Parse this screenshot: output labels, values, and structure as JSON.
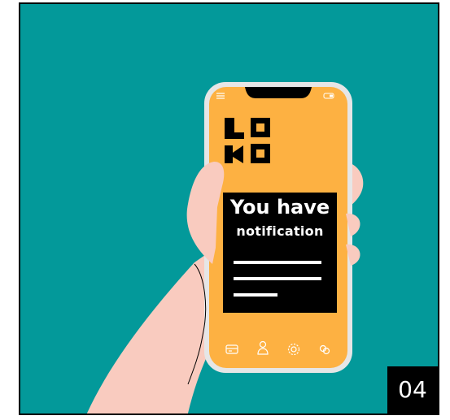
{
  "notification": {
    "title": "You have",
    "subtitle": "notification"
  },
  "page_number": "04",
  "icons": {
    "menu": "menu-icon",
    "battery": "battery-icon",
    "logo": "loko-logo",
    "nav": [
      "card-icon",
      "user-icon",
      "settings-icon",
      "link-icon"
    ]
  },
  "colors": {
    "background": "#03999a",
    "phone_screen": "#fdb142",
    "notification_panel": "#000000",
    "skin": "#f9cbbf",
    "phone_frame": "#e6e6e6"
  }
}
